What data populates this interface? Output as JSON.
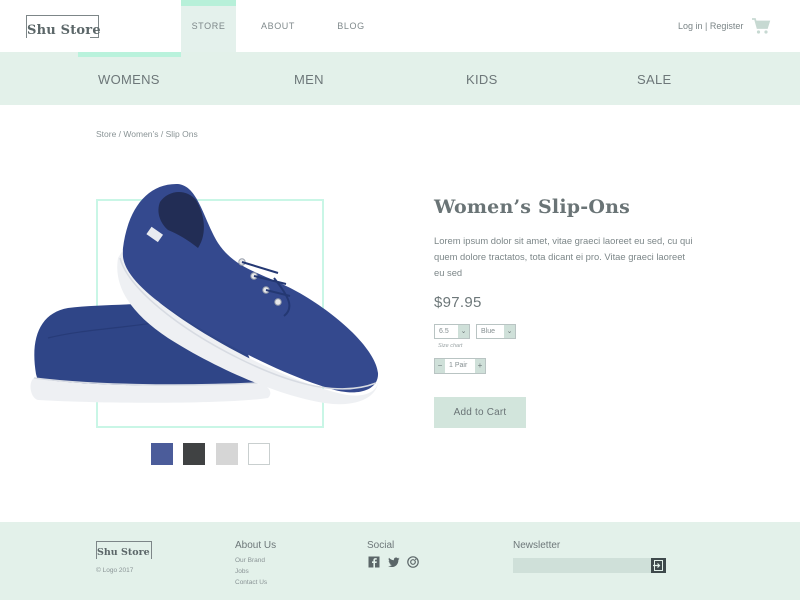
{
  "brand": {
    "name": "Shu Store"
  },
  "top_nav": {
    "store": "STORE",
    "about": "ABOUT",
    "blog": "BLOG"
  },
  "auth": {
    "text": "Log in | Register"
  },
  "category_nav": {
    "womens": "WOMENS",
    "men": "MEN",
    "kids": "KIDS",
    "sale": "SALE"
  },
  "breadcrumb": "Store / Women’s / Slip Ons",
  "product": {
    "title": "Women’s Slip-Ons",
    "description": "Lorem ipsum dolor sit amet, vitae graeci laoreet eu sed, cu qui quem dolore tractatos, tota dicant ei pro. Vitae graeci laoreet eu sed",
    "price": "$97.95",
    "size_select": "6.5",
    "color_select": "Blue",
    "size_chart_link": "Size chart",
    "quantity": "1 Pair",
    "qty_minus": "−",
    "qty_plus": "+",
    "select_arrow": "⌄",
    "add_to_cart": "Add to Cart",
    "swatch_colors": [
      "#4b5c9a",
      "#404243",
      "#d6d6d6",
      "#ffffff"
    ]
  },
  "footer": {
    "logo": "Shu Store",
    "copyright": "© Logo 2017",
    "about_heading": "About Us",
    "about_links": [
      "Our Brand",
      "Jobs",
      "Contact Us"
    ],
    "social_heading": "Social",
    "newsletter_heading": "Newsletter"
  },
  "colors": {
    "mint": "#e3f1ea",
    "accent": "#b7f0d9",
    "text": "#6b7476",
    "shoe": "#2f4587"
  }
}
